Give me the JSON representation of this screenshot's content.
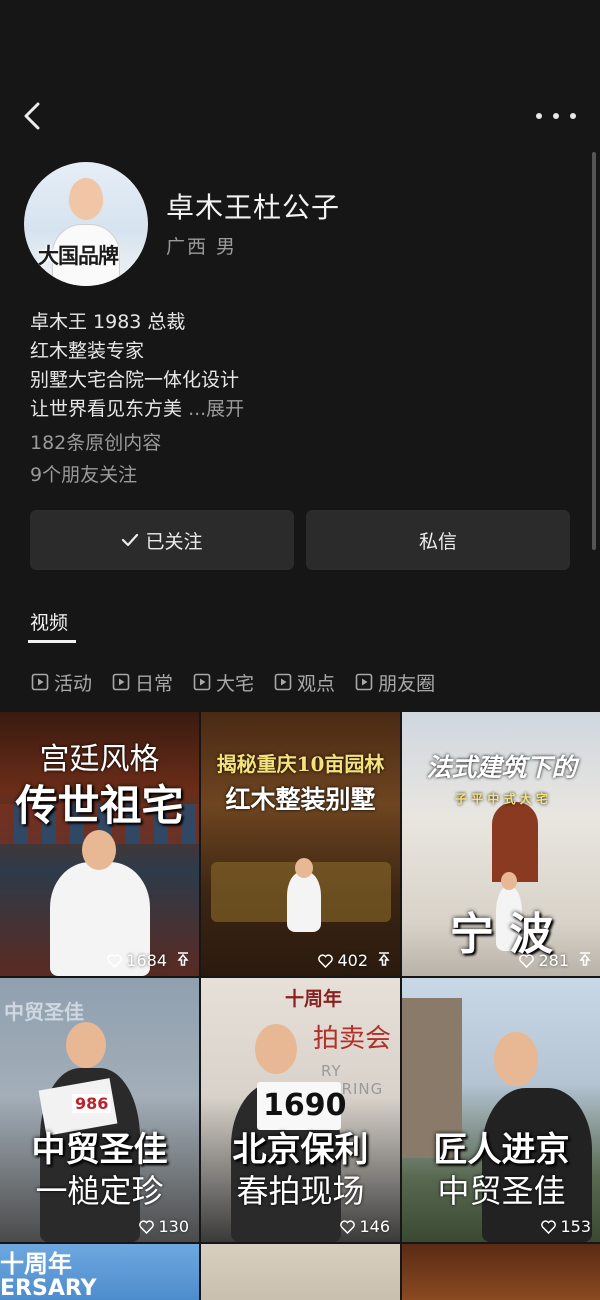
{
  "header": {
    "back_icon": "chevron-left-icon",
    "more_icon": "more-dots-icon"
  },
  "profile": {
    "name": "卓木王杜公子",
    "location": "广西 男",
    "avatar_logo_text": "大国品牌",
    "bio_lines": [
      "卓木王 1983 总裁",
      "红木整装专家",
      "别墅大宅合院一体化设计",
      "让世界看见东方美"
    ],
    "expand_label": "...展开",
    "original_count": "182条原创内容",
    "friends_following": "9个朋友关注"
  },
  "actions": {
    "follow_label": "已关注",
    "message_label": "私信"
  },
  "tabs": {
    "active": "视频"
  },
  "chips": [
    "活动",
    "日常",
    "大宅",
    "观点",
    "朋友圈"
  ],
  "videos": [
    {
      "title_top": "宫廷风格",
      "title_main": "传世祖宅",
      "likes": "1684"
    },
    {
      "title_top": "揭秘重庆10亩园林",
      "title_main": "红木整装别墅",
      "likes": "402"
    },
    {
      "title_top": "法式建筑下的",
      "subtitle": "子 平 中 式 大 宅",
      "title_main": "宁 波",
      "likes": "281"
    },
    {
      "title_main": "中贸圣佳",
      "title_sub": "一槌定珍",
      "likes": "130",
      "bg_text": "中贸圣佳",
      "card_number": "986"
    },
    {
      "title_main": "北京保利",
      "title_sub": "春拍现场",
      "likes": "146",
      "bg_text": "拍卖会",
      "bg_text2": "RY SPRING",
      "bg_text3": "十周年",
      "card_number": "1690"
    },
    {
      "title_main": "匠人进京",
      "title_sub": "中贸圣佳",
      "likes": "153"
    },
    {
      "bg_text": "十周年",
      "bg_text2": "ERSARY"
    }
  ],
  "colors": {
    "background": "#161616",
    "button_bg": "#2b2b2b",
    "muted_text": "#9a9a9a"
  }
}
